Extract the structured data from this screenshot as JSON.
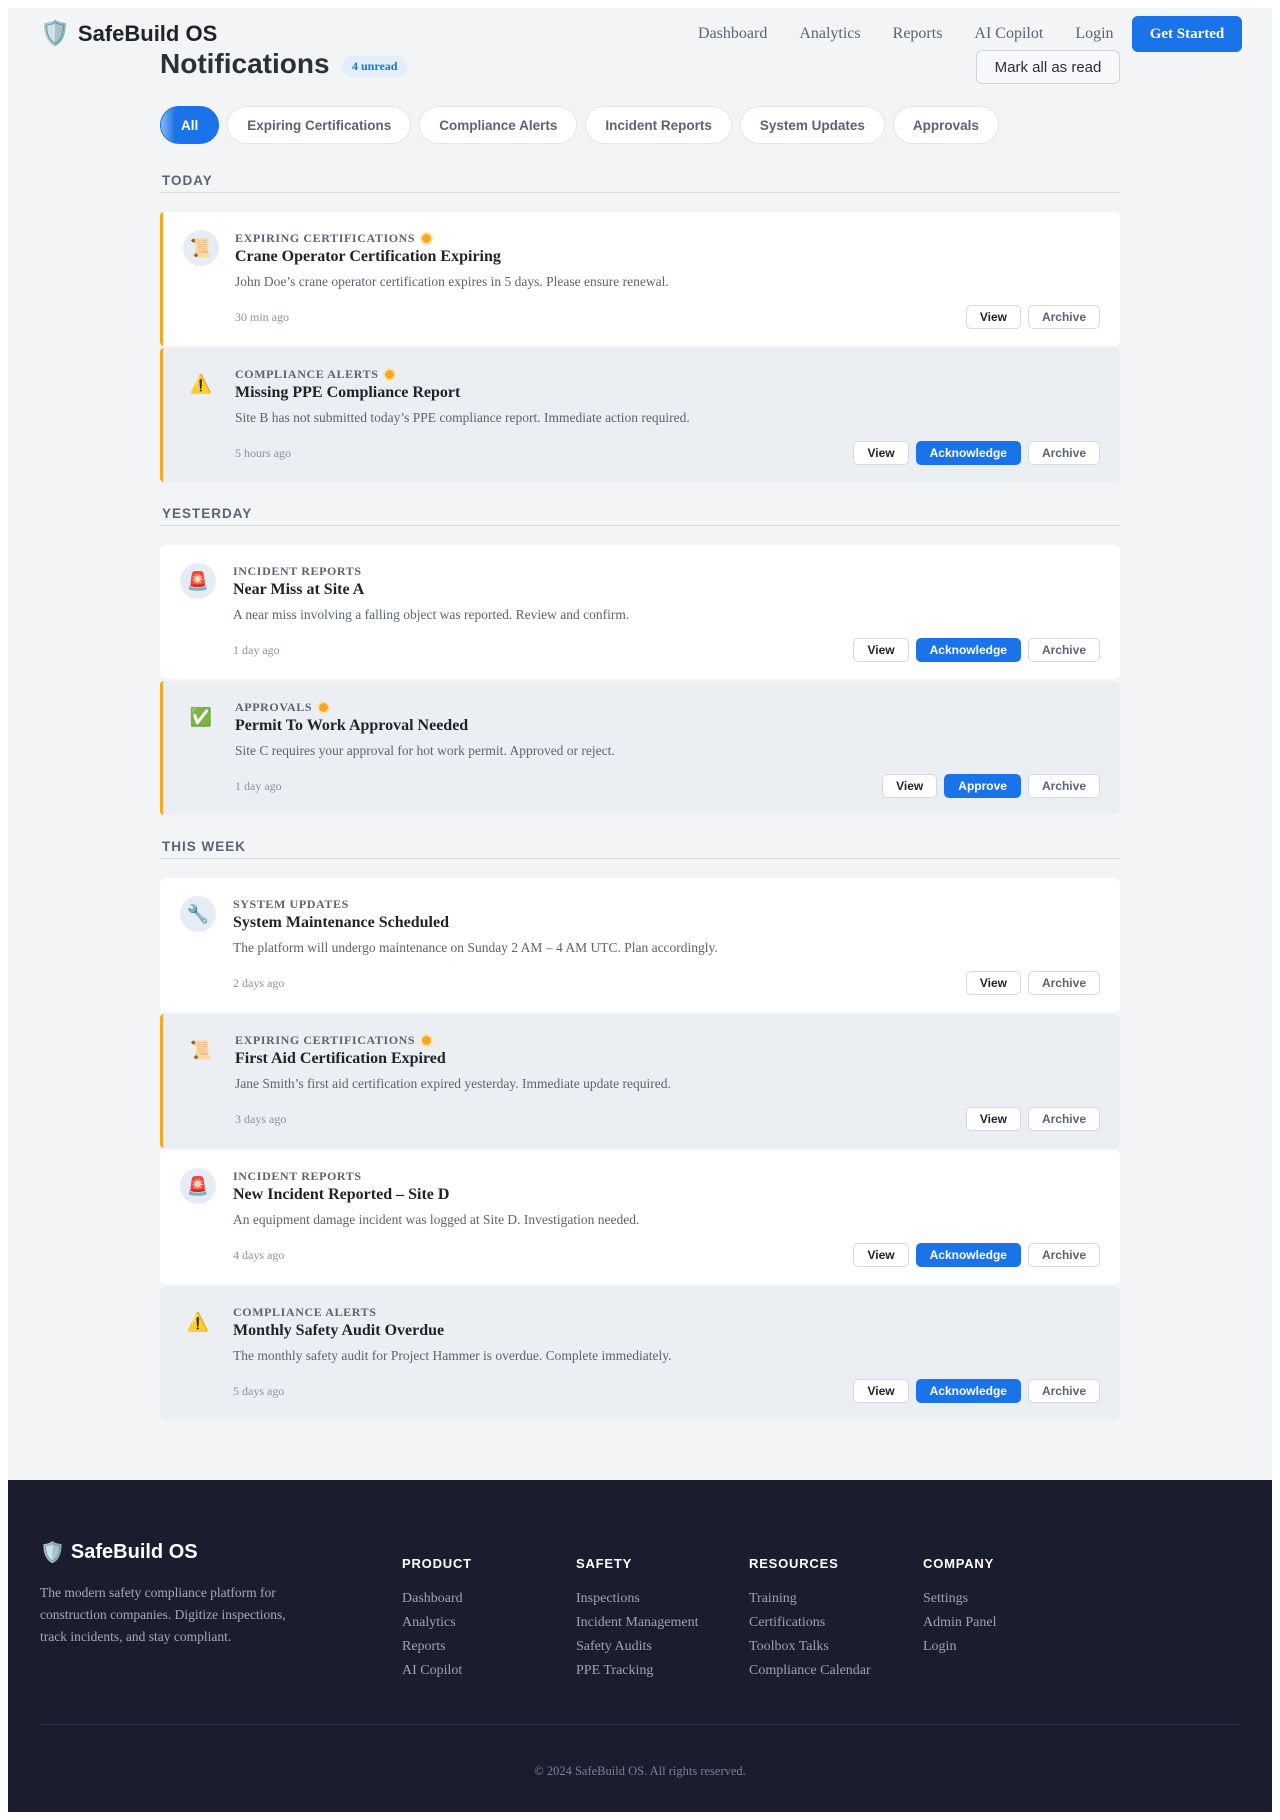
{
  "header": {
    "brand": "SafeBuild OS",
    "brand_icon": "shield-icon",
    "nav": [
      "Dashboard",
      "Analytics",
      "Reports",
      "AI Copilot",
      "Login"
    ],
    "cta": "Get Started"
  },
  "page": {
    "title": "Notifications",
    "unread_badge": "4 unread",
    "mark_all": "Mark all as read"
  },
  "filters": [
    "All",
    "Expiring Certifications",
    "Compliance Alerts",
    "Incident Reports",
    "System Updates",
    "Approvals"
  ],
  "active_filter": "All",
  "groups": [
    {
      "label": "TODAY",
      "items": [
        {
          "icon": "scroll",
          "category": "EXPIRING CERTIFICATIONS",
          "unread": true,
          "title": "Crane Operator Certification Expiring",
          "description": "John Doe’s crane operator certification expires in 5 days. Please ensure renewal.",
          "time": "30 min ago",
          "actions": [
            "View",
            "Archive"
          ]
        },
        {
          "icon": "warning",
          "category": "COMPLIANCE ALERTS",
          "unread": true,
          "title": "Missing PPE Compliance Report",
          "description": "Site B has not submitted today’s PPE compliance report. Immediate action required.",
          "time": "5 hours ago",
          "actions": [
            "View",
            "Acknowledge",
            "Archive"
          ]
        }
      ]
    },
    {
      "label": "YESTERDAY",
      "items": [
        {
          "icon": "siren",
          "category": "INCIDENT REPORTS",
          "unread": false,
          "title": "Near Miss at Site A",
          "description": "A near miss involving a falling object was reported. Review and confirm.",
          "time": "1 day ago",
          "actions": [
            "View",
            "Acknowledge",
            "Archive"
          ]
        },
        {
          "icon": "check",
          "category": "APPROVALS",
          "unread": true,
          "title": "Permit To Work Approval Needed",
          "description": "Site C requires your approval for hot work permit. Approved or reject.",
          "time": "1 day ago",
          "actions": [
            "View",
            "Approve",
            "Archive"
          ]
        }
      ]
    },
    {
      "label": "THIS WEEK",
      "items": [
        {
          "icon": "wrench",
          "category": "SYSTEM UPDATES",
          "unread": false,
          "title": "System Maintenance Scheduled",
          "description": "The platform will undergo maintenance on Sunday 2 AM – 4 AM UTC. Plan accordingly.",
          "time": "2 days ago",
          "actions": [
            "View",
            "Archive"
          ]
        },
        {
          "icon": "scroll",
          "category": "EXPIRING CERTIFICATIONS",
          "unread": true,
          "title": "First Aid Certification Expired",
          "description": "Jane Smith’s first aid certification expired yesterday. Immediate update required.",
          "time": "3 days ago",
          "actions": [
            "View",
            "Archive"
          ]
        },
        {
          "icon": "siren",
          "category": "INCIDENT REPORTS",
          "unread": false,
          "title": "New Incident Reported – Site D",
          "description": "An equipment damage incident was logged at Site D. Investigation needed.",
          "time": "4 days ago",
          "actions": [
            "View",
            "Acknowledge",
            "Archive"
          ]
        },
        {
          "icon": "warning",
          "category": "COMPLIANCE ALERTS",
          "unread": false,
          "title": "Monthly Safety Audit Overdue",
          "description": "The monthly safety audit for Project Hammer is overdue. Complete immediately.",
          "time": "5 days ago",
          "actions": [
            "View",
            "Acknowledge",
            "Archive"
          ]
        }
      ]
    }
  ],
  "footer": {
    "brand": "SafeBuild OS",
    "tagline": "The modern safety compliance platform for construction companies. Digitize inspections, track incidents, and stay compliant.",
    "columns": [
      {
        "heading": "PRODUCT",
        "links": [
          "Dashboard",
          "Analytics",
          "Reports",
          "AI Copilot"
        ]
      },
      {
        "heading": "SAFETY",
        "links": [
          "Inspections",
          "Incident Management",
          "Safety Audits",
          "PPE Tracking"
        ]
      },
      {
        "heading": "RESOURCES",
        "links": [
          "Training",
          "Certifications",
          "Toolbox Talks",
          "Compliance Calendar"
        ]
      },
      {
        "heading": "COMPANY",
        "links": [
          "Settings",
          "Admin Panel",
          "Login"
        ]
      }
    ],
    "copyright": "© 2024 SafeBuild OS. All rights reserved."
  },
  "colors": {
    "accent": "#1a73e8",
    "unread_dot": "#f5a623",
    "footer_bg": "#1b1d2f"
  }
}
